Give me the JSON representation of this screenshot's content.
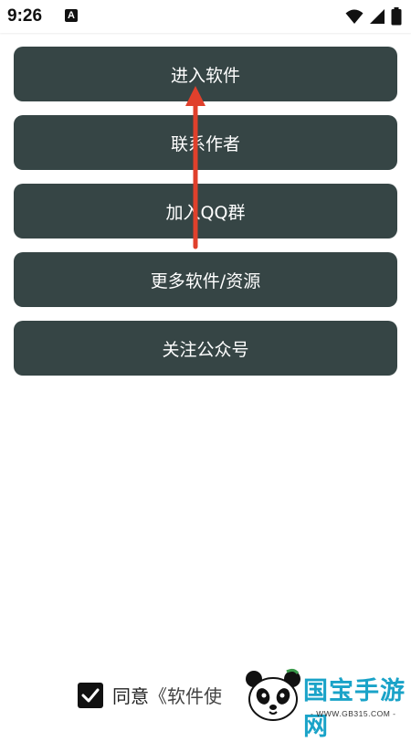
{
  "status_bar": {
    "time": "9:26",
    "notification_icon": "A"
  },
  "menu": {
    "items": [
      {
        "label": "进入软件"
      },
      {
        "label": "联系作者"
      },
      {
        "label": "加入QQ群"
      },
      {
        "label": "更多软件/资源"
      },
      {
        "label": "关注公众号"
      }
    ]
  },
  "agreement": {
    "checked": true,
    "prefix": "同意",
    "link_fragment": "《软件使"
  },
  "watermark": {
    "brand": "国宝手游网",
    "url": "- WWW.GB315.COM -"
  },
  "colors": {
    "button_bg": "#364545",
    "arrow": "#e0402c",
    "watermark_brand": "#1aa3c8"
  }
}
